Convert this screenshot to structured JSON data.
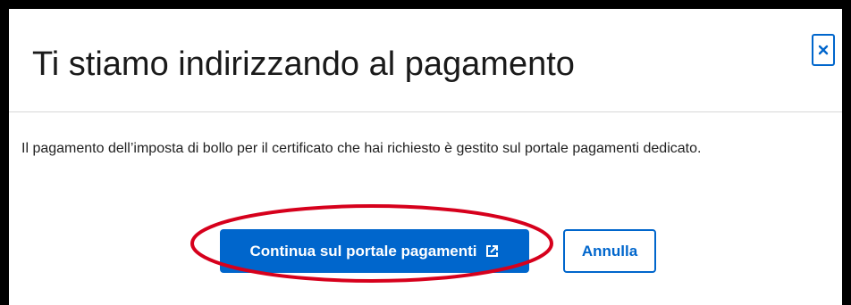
{
  "dialog": {
    "title": "Ti stiamo indirizzando al pagamento",
    "close_icon": "close-icon",
    "body_text": "Il pagamento dell’imposta di bollo per il certificato che hai richiesto è gestito sul portale pagamenti dedicato.",
    "primary_button": {
      "label": "Continua sul portale pagamenti",
      "icon": "external-link-icon"
    },
    "secondary_button": {
      "label": "Annulla"
    }
  },
  "colors": {
    "primary": "#0066cc",
    "annotation": "#d6001c",
    "frame": "#000000"
  }
}
